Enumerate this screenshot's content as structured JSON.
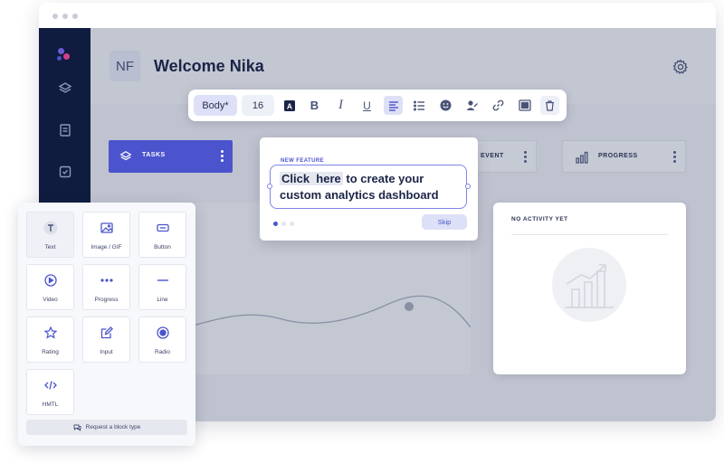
{
  "header": {
    "avatar_initials": "NF",
    "welcome_text": "Welcome Nika"
  },
  "sidebar": {
    "icons": [
      "layers-icon",
      "document-icon",
      "checkbox-icon"
    ]
  },
  "cards": {
    "tasks_label": "TASKS",
    "event_label": "EVENT",
    "progress_label": "PROGRESS"
  },
  "toolbar": {
    "style_value": "Body*",
    "font_size": "16",
    "buttons": [
      "text-color-icon",
      "bold-icon",
      "italic-icon",
      "underline-icon",
      "align-left-icon",
      "list-icon",
      "emoji-icon",
      "person-icon",
      "link-icon",
      "frame-icon",
      "trash-icon"
    ]
  },
  "feature_popover": {
    "tag": "NEW FEATURE",
    "highlight": "Click  here",
    "text_rest": " to create your custom analytics dashboard",
    "skip_label": "Skip",
    "steps": 3,
    "active_step": 1
  },
  "activity": {
    "title": "NO ACTIVITY YET"
  },
  "palette": {
    "blocks": [
      {
        "label": "Text",
        "icon": "text-icon"
      },
      {
        "label": "Image / GIF",
        "icon": "image-icon"
      },
      {
        "label": "Button",
        "icon": "button-icon"
      },
      {
        "label": "Video",
        "icon": "play-icon"
      },
      {
        "label": "Progress",
        "icon": "dots-icon"
      },
      {
        "label": "Line",
        "icon": "line-icon"
      },
      {
        "label": "Rating",
        "icon": "star-icon"
      },
      {
        "label": "Input",
        "icon": "edit-icon"
      },
      {
        "label": "Radio",
        "icon": "radio-icon"
      },
      {
        "label": "HMTL",
        "icon": "code-icon"
      }
    ],
    "request_label": "Request a block type"
  },
  "colors": {
    "accent": "#4b54cc",
    "sidebar": "#0f1c3f",
    "overlay": "#bfc3cf"
  }
}
